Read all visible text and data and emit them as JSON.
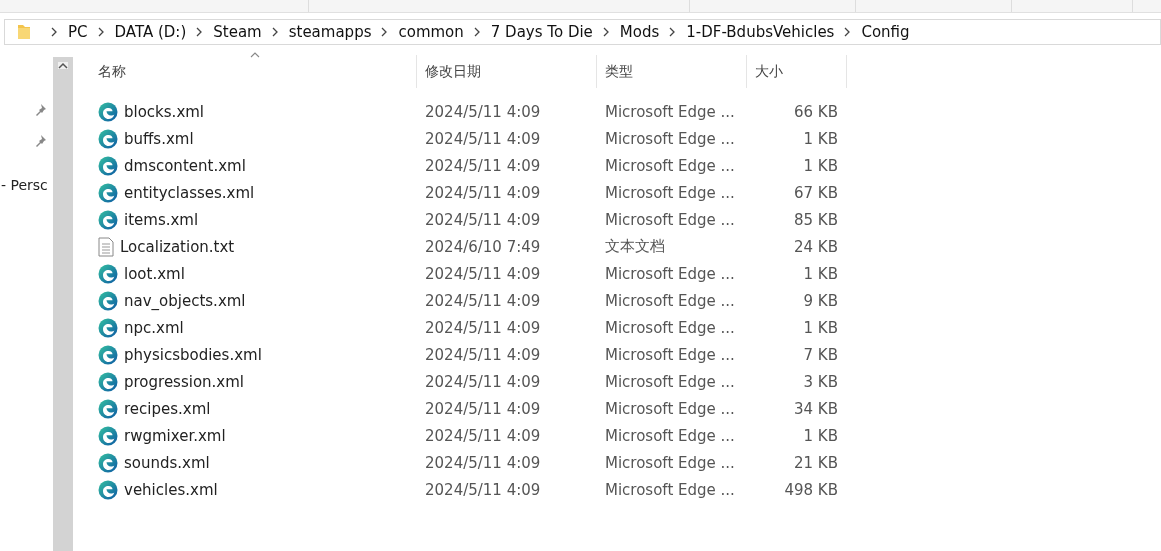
{
  "address_bar": {
    "crumbs": [
      "PC",
      "DATA (D:)",
      "Steam",
      "steamapps",
      "common",
      "7 Days To Die",
      "Mods",
      "1-DF-BdubsVehicles",
      "Config"
    ]
  },
  "navigation_pane": {
    "items": [
      {
        "kind": "pinned"
      },
      {
        "kind": "pinned"
      },
      {
        "kind": "label",
        "label": "- Persc"
      }
    ]
  },
  "table": {
    "columns": [
      "名称",
      "修改日期",
      "类型",
      "大小"
    ],
    "rows": [
      {
        "kind": "edge",
        "name": "blocks.xml",
        "modified": "2024/5/11 4:09",
        "type": "Microsoft Edge ...",
        "size": "66 KB"
      },
      {
        "kind": "edge",
        "name": "buffs.xml",
        "modified": "2024/5/11 4:09",
        "type": "Microsoft Edge ...",
        "size": "1 KB"
      },
      {
        "kind": "edge",
        "name": "dmscontent.xml",
        "modified": "2024/5/11 4:09",
        "type": "Microsoft Edge ...",
        "size": "1 KB"
      },
      {
        "kind": "edge",
        "name": "entityclasses.xml",
        "modified": "2024/5/11 4:09",
        "type": "Microsoft Edge ...",
        "size": "67 KB"
      },
      {
        "kind": "edge",
        "name": "items.xml",
        "modified": "2024/5/11 4:09",
        "type": "Microsoft Edge ...",
        "size": "85 KB"
      },
      {
        "kind": "text",
        "name": "Localization.txt",
        "modified": "2024/6/10 7:49",
        "type": "文本文档",
        "size": "24 KB"
      },
      {
        "kind": "edge",
        "name": "loot.xml",
        "modified": "2024/5/11 4:09",
        "type": "Microsoft Edge ...",
        "size": "1 KB"
      },
      {
        "kind": "edge",
        "name": "nav_objects.xml",
        "modified": "2024/5/11 4:09",
        "type": "Microsoft Edge ...",
        "size": "9 KB"
      },
      {
        "kind": "edge",
        "name": "npc.xml",
        "modified": "2024/5/11 4:09",
        "type": "Microsoft Edge ...",
        "size": "1 KB"
      },
      {
        "kind": "edge",
        "name": "physicsbodies.xml",
        "modified": "2024/5/11 4:09",
        "type": "Microsoft Edge ...",
        "size": "7 KB"
      },
      {
        "kind": "edge",
        "name": "progression.xml",
        "modified": "2024/5/11 4:09",
        "type": "Microsoft Edge ...",
        "size": "3 KB"
      },
      {
        "kind": "edge",
        "name": "recipes.xml",
        "modified": "2024/5/11 4:09",
        "type": "Microsoft Edge ...",
        "size": "34 KB"
      },
      {
        "kind": "edge",
        "name": "rwgmixer.xml",
        "modified": "2024/5/11 4:09",
        "type": "Microsoft Edge ...",
        "size": "1 KB"
      },
      {
        "kind": "edge",
        "name": "sounds.xml",
        "modified": "2024/5/11 4:09",
        "type": "Microsoft Edge ...",
        "size": "21 KB"
      },
      {
        "kind": "edge",
        "name": "vehicles.xml",
        "modified": "2024/5/11 4:09",
        "type": "Microsoft Edge ...",
        "size": "498 KB"
      }
    ]
  }
}
